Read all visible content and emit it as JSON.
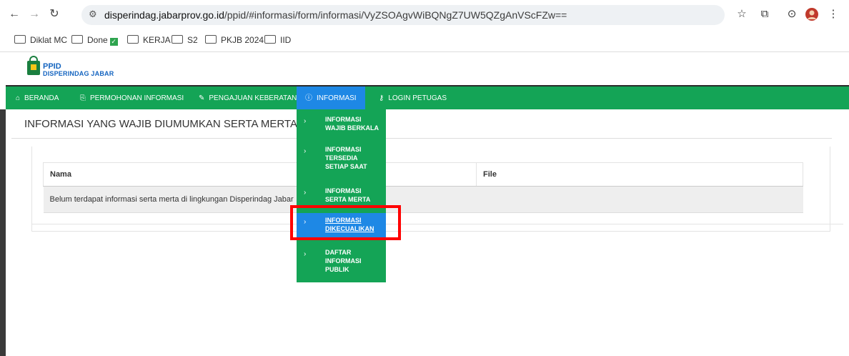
{
  "browser": {
    "url_domain": "disperindag.jabarprov.go.id",
    "url_path": "/ppid/#informasi/form/informasi/VyZSOAgvWiBQNgZ7UW5QZgAnVScFZw==",
    "icons": [
      "back-icon",
      "forward-icon",
      "reload-icon",
      "site-info-icon",
      "star-icon",
      "extensions-icon",
      "profile-sync-icon",
      "avatar-icon",
      "menu-icon"
    ]
  },
  "bookmarks": [
    {
      "label": "Diklat MC"
    },
    {
      "label": "Done",
      "badge": "✓"
    },
    {
      "label": "KERJA"
    },
    {
      "label": "S2"
    },
    {
      "label": "PKJB 2024"
    },
    {
      "label": "IID"
    }
  ],
  "logo": {
    "line1": "PPID",
    "line2": "DISPERINDAG JABAR"
  },
  "navbar": {
    "items": [
      {
        "label": "BERANDA",
        "icon": "home-icon"
      },
      {
        "label": "PERMOHONAN INFORMASI",
        "icon": "request-icon"
      },
      {
        "label": "PENGAJUAN KEBERATAN",
        "icon": "edit-icon"
      },
      {
        "label": "INFORMASI",
        "icon": "info-icon"
      },
      {
        "label": "LOGIN PETUGAS",
        "icon": "key-icon"
      }
    ],
    "active": "INFORMASI",
    "bg_color": "#14a456",
    "active_color": "#1e88e5"
  },
  "page": {
    "title": "INFORMASI YANG WAJIB DIUMUMKAN SERTA MERTA",
    "table": {
      "headers": [
        "Nama",
        "File"
      ],
      "rows": [
        [
          "Belum terdapat informasi serta merta di lingkungan Disperindag Jabar",
          ""
        ]
      ]
    }
  },
  "dropdown": {
    "items": [
      {
        "label": "INFORMASI\nWAJIB BERKALA"
      },
      {
        "label": "INFORMASI\nTERSEDIA\nSETIAP SAAT"
      },
      {
        "label": "INFORMASI\nSERTA MERTA"
      },
      {
        "label": "INFORMASI\nDIKECUALIKAN"
      },
      {
        "label": "DAFTAR\nINFORMASI\nPUBLIK"
      }
    ],
    "selected": "INFORMASI DIKECUALIKAN"
  },
  "highlight_color": "#ff0000"
}
